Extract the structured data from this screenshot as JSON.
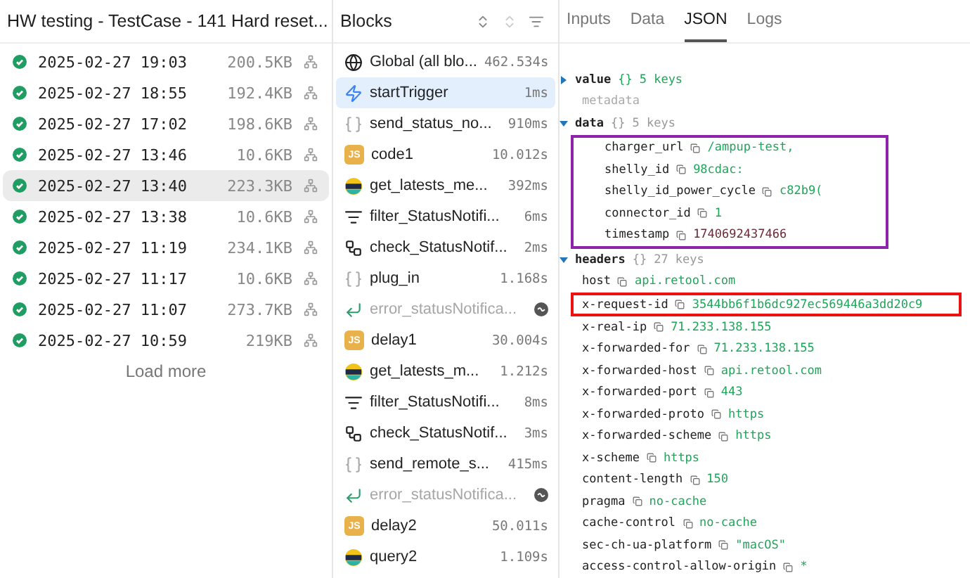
{
  "runs": {
    "title": "HW testing - TestCase - 141 Hard reset...",
    "items": [
      {
        "time": "2025-02-27 19:03",
        "size": "200.5KB",
        "selected": false
      },
      {
        "time": "2025-02-27 18:55",
        "size": "192.4KB",
        "selected": false
      },
      {
        "time": "2025-02-27 17:02",
        "size": "198.6KB",
        "selected": false
      },
      {
        "time": "2025-02-27 13:46",
        "size": "10.6KB",
        "selected": false
      },
      {
        "time": "2025-02-27 13:40",
        "size": "223.3KB",
        "selected": true
      },
      {
        "time": "2025-02-27 13:38",
        "size": "10.6KB",
        "selected": false
      },
      {
        "time": "2025-02-27 11:19",
        "size": "234.1KB",
        "selected": false
      },
      {
        "time": "2025-02-27 11:17",
        "size": "10.6KB",
        "selected": false
      },
      {
        "time": "2025-02-27 11:07",
        "size": "273.7KB",
        "selected": false
      },
      {
        "time": "2025-02-27 10:59",
        "size": "219KB",
        "selected": false
      }
    ],
    "load_more": "Load more"
  },
  "blocks": {
    "title": "Blocks",
    "items": [
      {
        "kind": "global",
        "name": "Global (all blo...",
        "duration": "462.534s",
        "selected": false
      },
      {
        "kind": "trigger",
        "name": "startTrigger",
        "duration": "1ms",
        "selected": true
      },
      {
        "kind": "api",
        "name": "send_status_no...",
        "duration": "910ms",
        "selected": false
      },
      {
        "kind": "js",
        "badge": "JS",
        "name": "code1",
        "duration": "10.012s",
        "selected": false
      },
      {
        "kind": "db",
        "name": "get_latests_me...",
        "duration": "392ms",
        "selected": false
      },
      {
        "kind": "filter",
        "name": "filter_StatusNotifi...",
        "duration": "6ms",
        "selected": false
      },
      {
        "kind": "branch",
        "name": "check_StatusNotif...",
        "duration": "2ms",
        "selected": false
      },
      {
        "kind": "api",
        "name": "plug_in",
        "duration": "1.168s",
        "selected": false
      },
      {
        "kind": "error",
        "name": "error_statusNotifica...",
        "selected": false
      },
      {
        "kind": "js",
        "badge": "JS",
        "name": "delay1",
        "duration": "30.004s",
        "selected": false
      },
      {
        "kind": "db",
        "name": "get_latests_m...",
        "duration": "1.212s",
        "selected": false
      },
      {
        "kind": "filter",
        "name": "filter_StatusNotifi...",
        "duration": "8ms",
        "selected": false
      },
      {
        "kind": "branch",
        "name": "check_StatusNotif...",
        "duration": "3ms",
        "selected": false
      },
      {
        "kind": "api",
        "name": "send_remote_s...",
        "duration": "415ms",
        "selected": false
      },
      {
        "kind": "error",
        "name": "error_statusNotifica...",
        "selected": false
      },
      {
        "kind": "js",
        "badge": "JS",
        "name": "delay2",
        "duration": "50.011s",
        "selected": false
      },
      {
        "kind": "db",
        "name": "query2",
        "duration": "1.109s",
        "selected": false
      }
    ]
  },
  "tabs": [
    {
      "label": "Inputs",
      "selected": false
    },
    {
      "label": "Data",
      "selected": false
    },
    {
      "label": "JSON",
      "selected": true
    },
    {
      "label": "Logs",
      "selected": false
    }
  ],
  "json_tree": [
    {
      "kind": "object",
      "key": "value",
      "braces": "{}",
      "summary": "5 keys",
      "expanded": false,
      "highlighted": true
    },
    {
      "kind": "label",
      "key": "metadata"
    },
    {
      "kind": "object",
      "key": "data",
      "braces": "{}",
      "summary": "5 keys",
      "expanded": true,
      "highlighted": false,
      "boxed": true,
      "children": [
        {
          "kind": "string",
          "key": "charger_url",
          "value": "/ampup-test,"
        },
        {
          "kind": "string",
          "key": "shelly_id",
          "value": "98cdac:"
        },
        {
          "kind": "string",
          "key": "shelly_id_power_cycle",
          "value": "c82b9("
        },
        {
          "kind": "string",
          "key": "connector_id",
          "value": "1"
        },
        {
          "kind": "number",
          "key": "timestamp",
          "value": "1740692437466"
        }
      ]
    },
    {
      "kind": "object",
      "key": "headers",
      "braces": "{}",
      "summary": "27 keys",
      "expanded": true,
      "highlighted": false,
      "children": [
        {
          "kind": "string",
          "key": "host",
          "value": "api.retool.com"
        },
        {
          "kind": "string",
          "key": "x-request-id",
          "value": "3544bb6f1b6dc927ec569446a3dd20c9",
          "boxed": true
        },
        {
          "kind": "string",
          "key": "x-real-ip",
          "value": "71.233.138.155"
        },
        {
          "kind": "string",
          "key": "x-forwarded-for",
          "value": "71.233.138.155"
        },
        {
          "kind": "string",
          "key": "x-forwarded-host",
          "value": "api.retool.com"
        },
        {
          "kind": "string",
          "key": "x-forwarded-port",
          "value": "443"
        },
        {
          "kind": "string",
          "key": "x-forwarded-proto",
          "value": "https"
        },
        {
          "kind": "string",
          "key": "x-forwarded-scheme",
          "value": "https"
        },
        {
          "kind": "string",
          "key": "x-scheme",
          "value": "https"
        },
        {
          "kind": "string",
          "key": "content-length",
          "value": "150"
        },
        {
          "kind": "string",
          "key": "pragma",
          "value": "no-cache"
        },
        {
          "kind": "string",
          "key": "cache-control",
          "value": "no-cache"
        },
        {
          "kind": "string",
          "key": "sec-ch-ua-platform",
          "value": "\"macOS\""
        },
        {
          "kind": "string",
          "key": "access-control-allow-origin",
          "value": "*"
        }
      ]
    }
  ]
}
